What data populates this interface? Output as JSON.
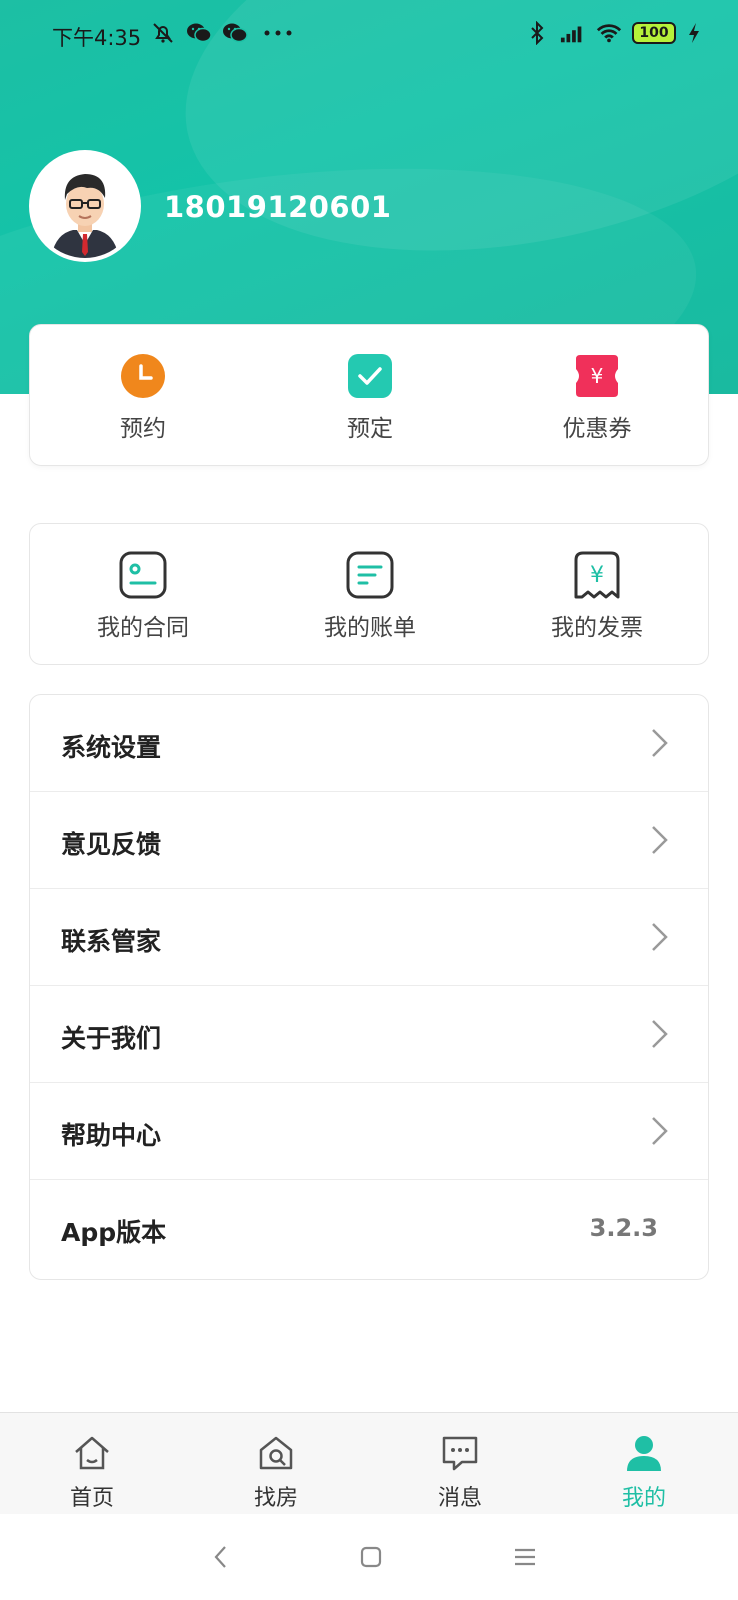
{
  "status_bar": {
    "time": "下午4:35",
    "battery": "100",
    "icons_left": [
      "mute-bell-icon",
      "wechat-icon",
      "wechat-icon",
      "more-dots-icon"
    ],
    "icons_right": [
      "bluetooth-icon",
      "signal-icon",
      "wifi-icon",
      "battery-icon",
      "charging-icon"
    ]
  },
  "profile": {
    "phone": "18019120601",
    "avatar": "avatar-man-glasses"
  },
  "quick_actions": [
    {
      "label": "预约",
      "icon": "clock-icon",
      "color": "#f0871c"
    },
    {
      "label": "预定",
      "icon": "check-icon",
      "color": "#24c9b1"
    },
    {
      "label": "优惠券",
      "icon": "coupon-icon",
      "color": "#f0305a"
    }
  ],
  "services": [
    {
      "label": "我的合同",
      "icon": "contract-icon"
    },
    {
      "label": "我的账单",
      "icon": "bill-icon"
    },
    {
      "label": "我的发票",
      "icon": "invoice-icon"
    }
  ],
  "menu": [
    {
      "label": "系统设置"
    },
    {
      "label": "意见反馈"
    },
    {
      "label": "联系管家"
    },
    {
      "label": "关于我们"
    },
    {
      "label": "帮助中心"
    },
    {
      "label": "App版本",
      "value": "3.2.3"
    }
  ],
  "tabbar": [
    {
      "label": "首页",
      "icon": "home-icon"
    },
    {
      "label": "找房",
      "icon": "search-house-icon"
    },
    {
      "label": "消息",
      "icon": "message-icon"
    },
    {
      "label": "我的",
      "icon": "profile-icon",
      "active": true
    }
  ],
  "colors": {
    "accent": "#1fbfa5",
    "hero": "#14c3a8"
  }
}
